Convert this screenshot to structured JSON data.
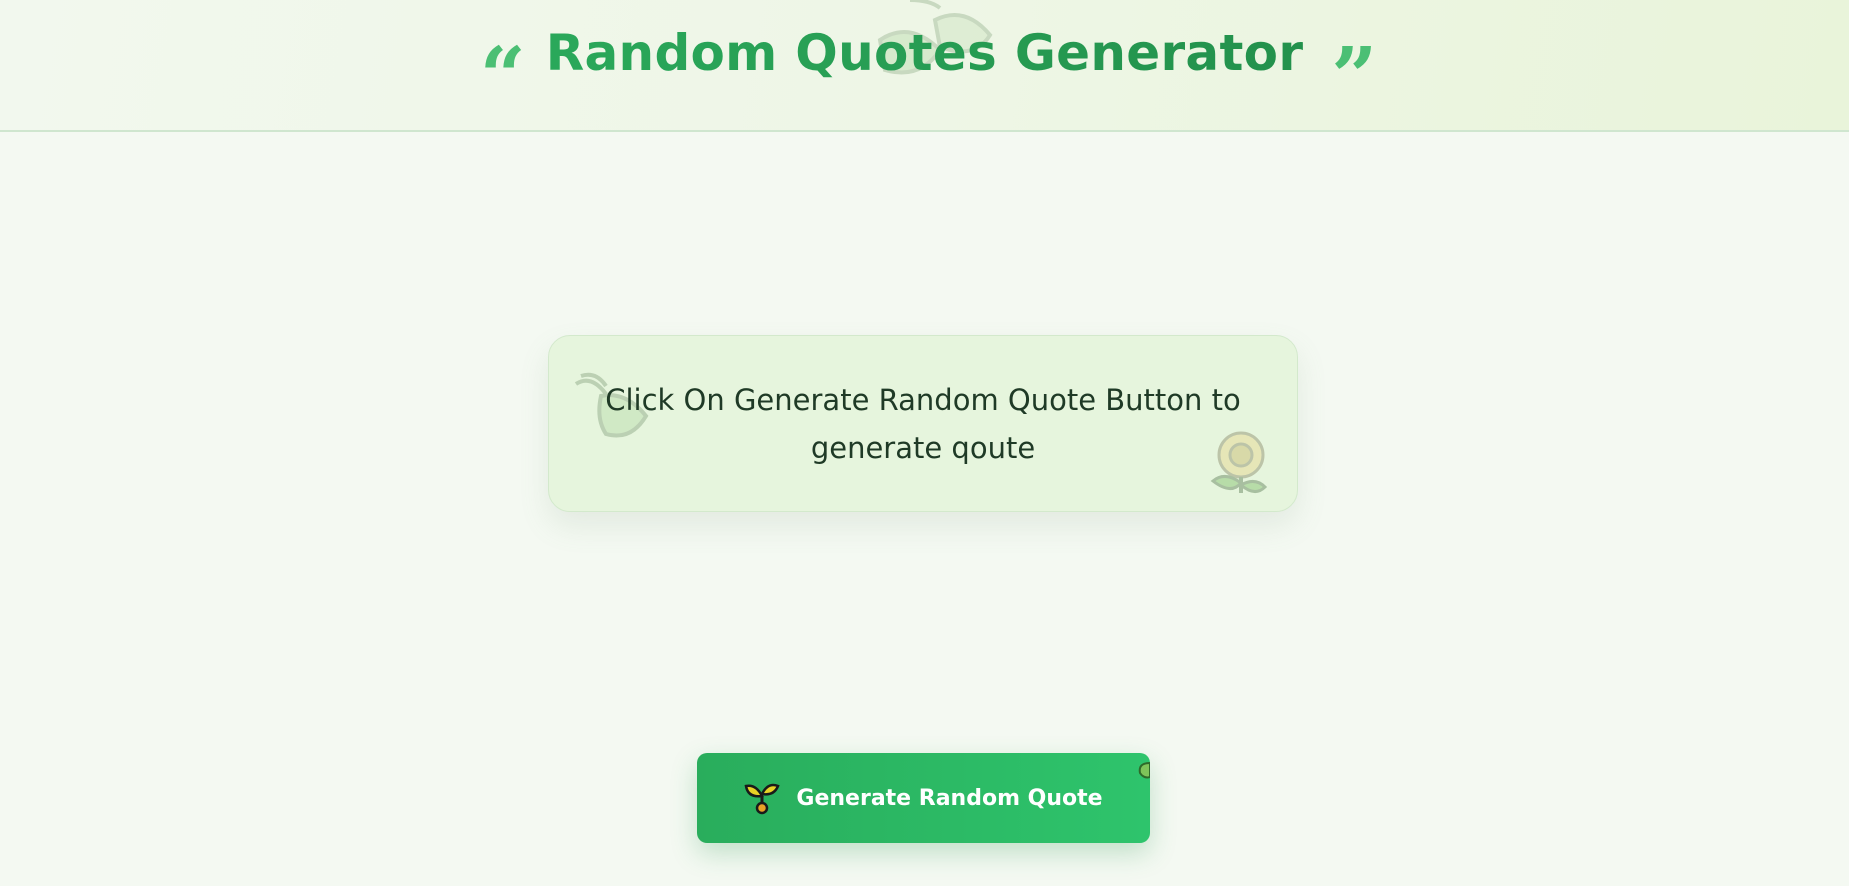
{
  "header": {
    "open_quote_icon": "opening-quote-icon",
    "title": "Random Quotes Generator",
    "close_quote_icon": "closing-quote-icon",
    "decor_icons": [
      "leaf-icon",
      "hand-leaf-icon"
    ]
  },
  "quote_card": {
    "text": "Click On Generate Random Quote Button to generate qoute",
    "decor_icons": [
      "hand-leaf-icon",
      "sunflower-icon"
    ]
  },
  "generate_button": {
    "icon": "seedling-icon",
    "label": "Generate Random Quote"
  },
  "colors": {
    "accent": "#2aa85a",
    "title": "#2a9d54",
    "quote_mark": "#4bbf74",
    "card_bg": "#e6f5dd",
    "button_start": "#29ad5c",
    "button_end": "#2ec46c",
    "page_bg": "#f4f9f2",
    "text": "#1f3a26"
  }
}
